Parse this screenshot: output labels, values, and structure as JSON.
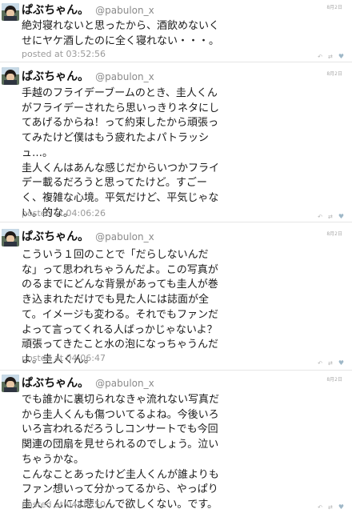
{
  "tweets": [
    {
      "name": "ぱぶちゃん。",
      "handle": "@pabulon_x",
      "date": "8月2日",
      "lines": [
        "絶対寝れないと思ったから、酒飲めないく",
        "せにヤケ酒したのに全く寝れない・・・。"
      ],
      "posted": "posted at 03:52:56"
    },
    {
      "name": "ぱぶちゃん。",
      "handle": "@pabulon_x",
      "date": "8月2日",
      "lines": [
        "手越のフライデーブームのとき、圭人くん",
        "がフライデーされたら思いっきりネタにし",
        "てあげるからね！って約束したから頑張っ",
        "てみたけど僕はもう疲れたよパトラッシ",
        "ュ…。",
        "圭人くんはあんな感じだからいつかフライ",
        "デー載るだろうと思ってたけど。すごー",
        "く、複雑な心境。平気だけど、平気じゃな",
        "い。的な。"
      ],
      "posted": "posted at 04:06:26"
    },
    {
      "name": "ぱぶちゃん。",
      "handle": "@pabulon_x",
      "date": "8月2日",
      "lines": [
        "こういう１回のことで「だらしないんだ",
        "な」って思われちゃうんだよ。この写真が",
        "のるまでにどんな背景があっても圭人が巻",
        "き込まれただけでも見た人には誌面が全",
        "て。イメージも変わる。それでもファンだ",
        "よって言ってくれる人ばっかじゃないよ？",
        "頑張ってきたこと水の泡になっちゃうんだ",
        "よ。圭人くん。"
      ],
      "posted": "posted at 04:06:47"
    },
    {
      "name": "ぱぶちゃん。",
      "handle": "@pabulon_x",
      "date": "8月2日",
      "lines": [
        "でも誰かに裏切られなきゃ流れない写真だ",
        "から圭人くんも傷ついてるよね。今後いろ",
        "いろ言われるだろうしコンサートでも今回",
        "関連の団扇を見せられるのでしょう。泣い",
        "ちゃうかな。",
        "こんなことあったけど圭人くんが誰よりも",
        "ファン想いって分かってるから、やっぱり",
        "圭人くんには悲しんで欲しくない。です。"
      ],
      "posted": "posted at 04:08:50"
    }
  ],
  "icons": {
    "reply": "reply-icon",
    "retweet": "retweet-icon",
    "favorite": "heart-icon"
  }
}
